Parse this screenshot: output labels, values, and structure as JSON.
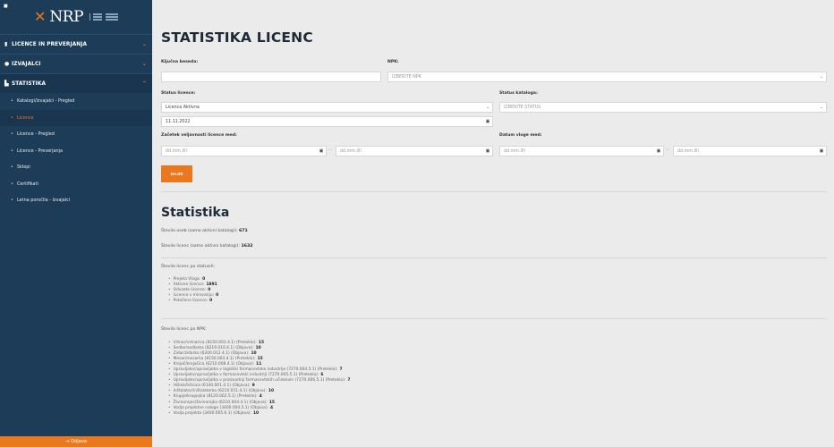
{
  "logo": {
    "text": "NRP"
  },
  "sidebar": {
    "sections": [
      {
        "icon": "document-icon",
        "label": "LICENCE IN PREVERJANJA"
      },
      {
        "icon": "user-icon",
        "label": "IZVAJALCI"
      },
      {
        "icon": "chart-icon",
        "label": "STATISTIKA"
      }
    ],
    "items": [
      {
        "label": "Katalogi/Izvajalci - Pregled"
      },
      {
        "label": "Licence"
      },
      {
        "label": "Licence - Pregled"
      },
      {
        "label": "Licence - Preverjanja"
      },
      {
        "label": "Sklepi"
      },
      {
        "label": "Certifikati"
      },
      {
        "label": "Letna poročila - Izvajalci"
      }
    ],
    "logout": "Odjava"
  },
  "page": {
    "title": "STATISTIKA LICENC"
  },
  "form": {
    "kljucna_label": "Ključna beseda:",
    "kljucna_value": "",
    "npk_label": "NPK:",
    "npk_placeholder": "IZBERITE NPK",
    "status_licence_label": "Status licence:",
    "status_licence_value": "Licenca Aktivna",
    "status_kataloga_label": "Status kataloga:",
    "status_kataloga_placeholder": "IZBERITE STATUS",
    "date_value": "11.11.2022",
    "zacetek_label": "Začetek veljavnosti licence med:",
    "datum_vloge_label": "Datum vloge med:",
    "date_placeholder": "dd.mm.llll",
    "dash": "—",
    "search_button": "NAJDI"
  },
  "stats": {
    "title": "Statistika",
    "oseb_label": "Število oseb (samo aktivni katalogi):",
    "oseb_value": "671",
    "licenc_label": "Število licenc (samo aktivni katalogi):",
    "licenc_value": "1632",
    "by_status_label": "Število licenc po statusih:",
    "by_status": [
      {
        "label": "Prejeta Vloga:",
        "count": "0"
      },
      {
        "label": "Aktivne licence:",
        "count": "1891"
      },
      {
        "label": "Odvzete licence:",
        "count": "0"
      },
      {
        "label": "Licence v mirovanju:",
        "count": "0"
      },
      {
        "label": "Potečene licence:",
        "count": "0"
      }
    ],
    "by_npk_label": "Število licenc po NPK:",
    "by_npk": [
      {
        "label": "Vrtnar/vrtnarica (8150.003.4.1) (Preteklo):",
        "count": "15"
      },
      {
        "label": "Sedlar/sedlarka (8219.010.4.1) (Objava):",
        "count": "10"
      },
      {
        "label": "Zidar/zidarka (6200.012.4.1) (Objava):",
        "count": "10"
      },
      {
        "label": "Mesar/mesarka (8150.003.4.1) (Preteklo):",
        "count": "15"
      },
      {
        "label": "Krojač/krojačica (6210.008.4.1) (Objava):",
        "count": "11"
      },
      {
        "label": "Upravljalec/upravljalka v logistiki farmacevtske industrije (7270.004.5.1) (Preteklo):",
        "count": "7"
      },
      {
        "label": "Upravljalec/upravljalka v farmacevtski industriji (7270.005.5.1) (Preteklo):",
        "count": "6"
      },
      {
        "label": "Upravljalec/upravljalka v proizvodnji farmacevtskih učinkovin (7270.006.5.1) (Preteklo):",
        "count": "7"
      },
      {
        "label": "Hišnik/hišnica (6140.001.4.1) (Objava):",
        "count": "9"
      },
      {
        "label": "Inštalater/inštalaterka (6210.011.4.1) (Objava):",
        "count": "10"
      },
      {
        "label": "Krupje/krupjejka (8120.002.5.1) (Preteklo):",
        "count": "4"
      },
      {
        "label": "Živinorejec/živinorejka (6210.004.4.1) (Objava):",
        "count": "15"
      },
      {
        "label": "Vodja projektne naloge (3400.004.5.1) (Objava):",
        "count": "4"
      },
      {
        "label": "Vodja projekta (3400.005.6.1) (Objava):",
        "count": "10"
      }
    ]
  }
}
